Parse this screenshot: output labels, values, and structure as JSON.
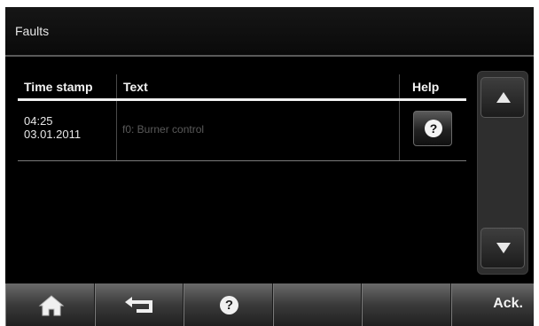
{
  "window": {
    "title": "Faults"
  },
  "table": {
    "headers": {
      "time": "Time stamp",
      "text": "Text",
      "help": "Help"
    },
    "rows": [
      {
        "time": "04:25",
        "date": "03.01.2011",
        "text": "f0: Burner control",
        "help_icon": "question-icon"
      }
    ]
  },
  "scroll": {
    "up_icon": "arrow-up-icon",
    "down_icon": "arrow-down-icon"
  },
  "bottombar": {
    "buttons": [
      {
        "icon": "home-icon"
      },
      {
        "icon": "back-arrow-icon"
      },
      {
        "icon": "question-icon"
      },
      {
        "label": ""
      },
      {
        "label": ""
      },
      {
        "label": "Ack."
      }
    ]
  },
  "colors": {
    "background": "#000000",
    "text": "#e8e8e8",
    "muted_text": "#5a5a5a"
  }
}
